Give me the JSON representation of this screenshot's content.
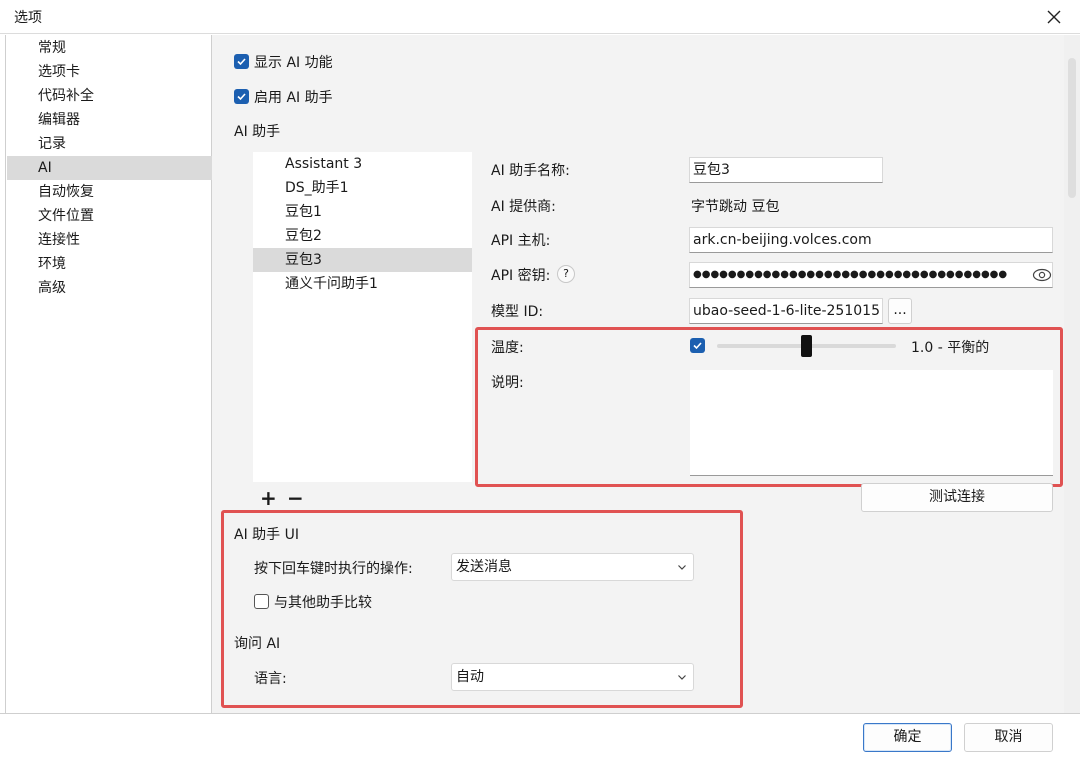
{
  "window": {
    "title": "选项"
  },
  "sidebar": {
    "items": [
      {
        "label": "常规"
      },
      {
        "label": "选项卡"
      },
      {
        "label": "代码补全"
      },
      {
        "label": "编辑器"
      },
      {
        "label": "记录"
      },
      {
        "label": "AI",
        "selected": true
      },
      {
        "label": "自动恢复"
      },
      {
        "label": "文件位置"
      },
      {
        "label": "连接性"
      },
      {
        "label": "环境"
      },
      {
        "label": "高级"
      }
    ]
  },
  "ai": {
    "show_ai": {
      "label": "显示 AI 功能",
      "checked": true
    },
    "enable_assistant": {
      "label": "启用 AI 助手",
      "checked": true
    },
    "assistants_heading": "AI 助手",
    "assistants": [
      {
        "label": "Assistant 3"
      },
      {
        "label": "DS_助手1"
      },
      {
        "label": "豆包1"
      },
      {
        "label": "豆包2"
      },
      {
        "label": "豆包3",
        "selected": true
      },
      {
        "label": "通义千问助手1"
      }
    ],
    "add_symbol": "+",
    "remove_symbol": "−",
    "form": {
      "name_label": "AI 助手名称:",
      "name_value": "豆包3",
      "provider_label": "AI 提供商:",
      "provider_value": "字节跳动 豆包",
      "host_label": "API 主机:",
      "host_value": "ark.cn-beijing.volces.com",
      "key_label": "API 密钥:",
      "key_help": "?",
      "key_value": "●●●●●●●●●●●●●●●●●●●●●●●●●●●●●●●●●●●●",
      "model_label": "模型 ID:",
      "model_value": "ubao-seed-1-6-lite-251015",
      "model_browse": "...",
      "temperature_label": "温度:",
      "temperature_enabled": true,
      "temperature_value": 1.0,
      "temperature_text": "1.0 - 平衡的",
      "description_label": "说明:",
      "description_value": "",
      "test_button": "测试连接"
    },
    "ui_section": {
      "heading": "AI 助手 UI",
      "enter_action_label": "按下回车键时执行的操作:",
      "enter_action_value": "发送消息",
      "compare_label": "与其他助手比较",
      "compare_checked": false
    },
    "ask_section": {
      "heading": "询问 AI",
      "language_label": "语言:",
      "language_value": "自动"
    }
  },
  "footer": {
    "ok": "确定",
    "cancel": "取消"
  },
  "colors": {
    "accent": "#1c5fb0",
    "highlight_border": "#e05252",
    "selected_bg": "#dadada"
  }
}
